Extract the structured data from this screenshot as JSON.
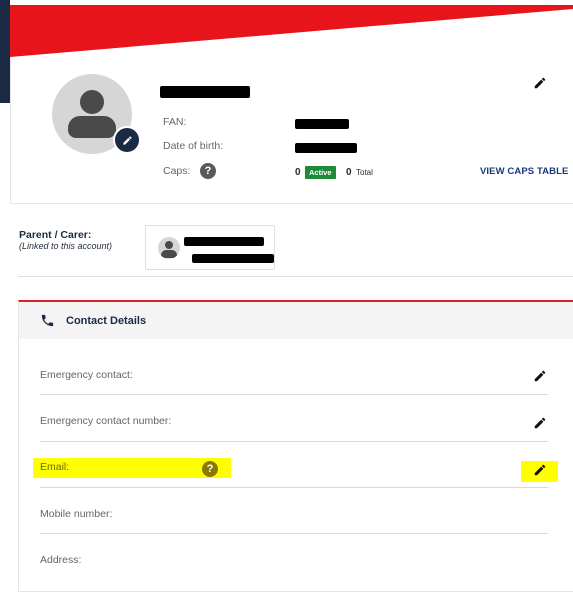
{
  "profile": {
    "fan_label": "FAN:",
    "dob_label": "Date of birth:",
    "caps_label": "Caps:",
    "caps_help_icon": "?",
    "active_count": "0",
    "active_badge": "Active",
    "total_count": "0",
    "total_label": "Total",
    "view_caps_link": "VIEW CAPS TABLE"
  },
  "parent_carer": {
    "title": "Parent / Carer:",
    "subtitle": "(Linked to this account)"
  },
  "contact": {
    "title": "Contact Details",
    "rows": [
      {
        "label": "Emergency contact:"
      },
      {
        "label": "Emergency contact number:"
      },
      {
        "label": "Email:",
        "help_icon": "?"
      },
      {
        "label": "Mobile number:"
      },
      {
        "label": "Address:"
      }
    ]
  },
  "colors": {
    "brand_red": "#e8141c",
    "navy": "#1a2a44",
    "highlight": "#ffff00",
    "active_green": "#1f8a3a"
  },
  "icons": {
    "edit": "pencil-icon",
    "phone": "phone-icon",
    "help": "question-circle-icon",
    "avatar": "user-avatar-icon"
  }
}
